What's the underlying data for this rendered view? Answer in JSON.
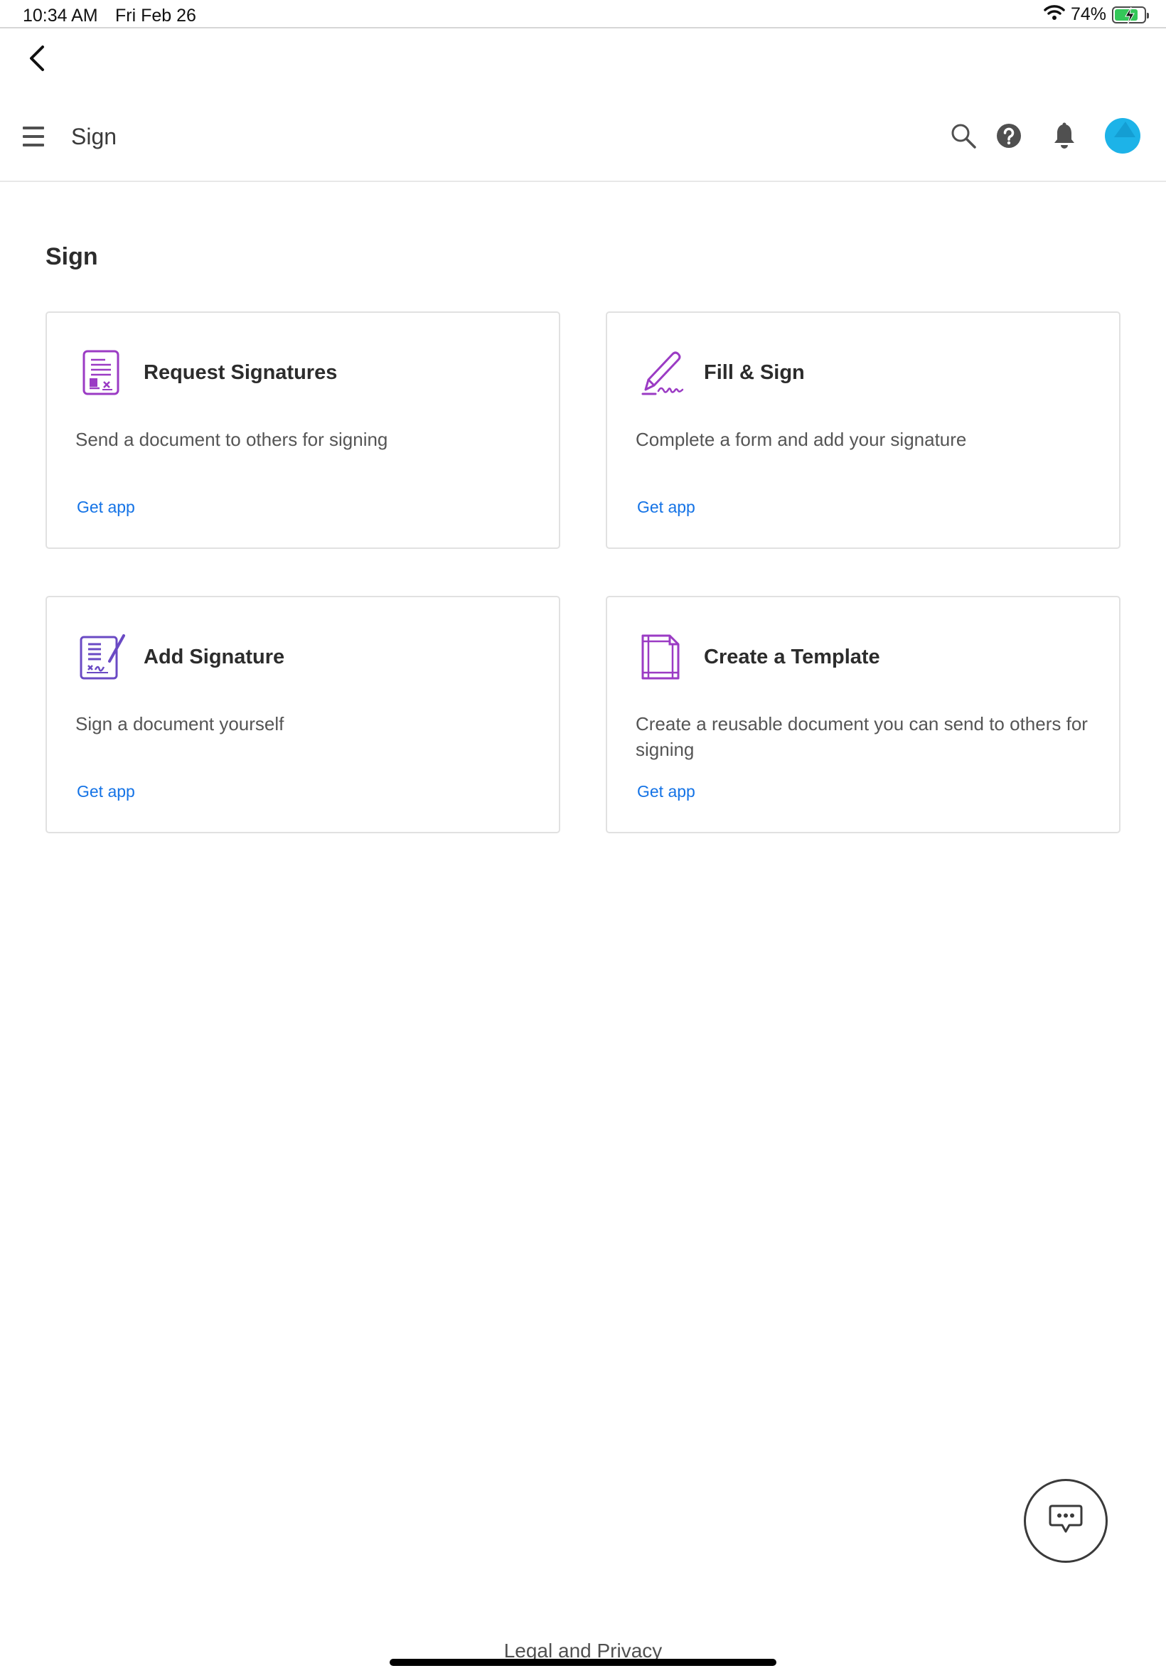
{
  "status_bar": {
    "time": "10:34 AM",
    "date": "Fri Feb 26",
    "battery_percent_label": "74%",
    "battery_level": 0.74,
    "icons": [
      "wifi-icon",
      "battery-charging-icon"
    ]
  },
  "header": {
    "title": "Sign",
    "icons": [
      "back-chevron-icon",
      "hamburger-menu-icon",
      "search-icon",
      "help-icon",
      "bell-icon",
      "avatar"
    ],
    "avatar_color": "#1db3e8"
  },
  "main": {
    "page_title": "Sign",
    "cards": [
      {
        "title": "Request Signatures",
        "description": "Send a document to others for signing",
        "link": "Get app",
        "icon": "request-signatures-icon"
      },
      {
        "title": "Fill & Sign",
        "description": "Complete a form and add your signature",
        "link": "Get app",
        "icon": "fill-sign-icon"
      },
      {
        "title": "Add Signature",
        "description": "Sign a document yourself",
        "link": "Get app",
        "icon": "add-signature-icon"
      },
      {
        "title": "Create a Template",
        "description": "Create a reusable document you can send to others for signing",
        "link": "Get app",
        "icon": "template-icon"
      }
    ]
  },
  "footer": {
    "legal": "Legal and Privacy"
  },
  "colors": {
    "accent_link": "#1473e6",
    "icon_purple": "#9b3bc4",
    "avatar": "#1db3e8"
  }
}
